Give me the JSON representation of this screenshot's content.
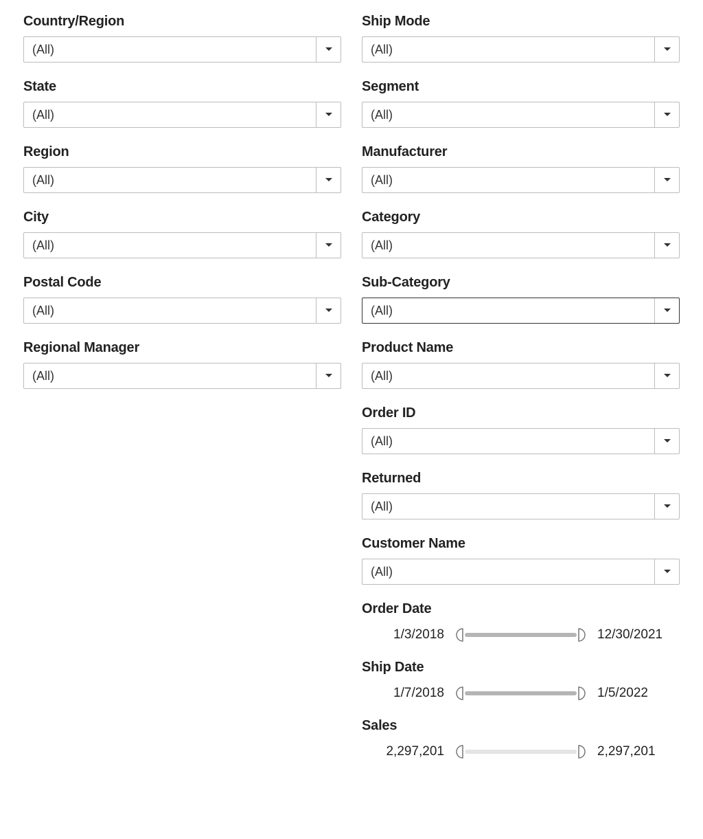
{
  "left": [
    {
      "name": "country-region",
      "label": "Country/Region",
      "value": "(All)"
    },
    {
      "name": "state",
      "label": "State",
      "value": "(All)"
    },
    {
      "name": "region",
      "label": "Region",
      "value": "(All)"
    },
    {
      "name": "city",
      "label": "City",
      "value": "(All)"
    },
    {
      "name": "postal-code",
      "label": "Postal Code",
      "value": "(All)"
    },
    {
      "name": "regional-manager",
      "label": "Regional Manager",
      "value": "(All)"
    }
  ],
  "right": [
    {
      "name": "ship-mode",
      "label": "Ship Mode",
      "value": "(All)"
    },
    {
      "name": "segment",
      "label": "Segment",
      "value": "(All)"
    },
    {
      "name": "manufacturer",
      "label": "Manufacturer",
      "value": "(All)"
    },
    {
      "name": "category",
      "label": "Category",
      "value": "(All)"
    },
    {
      "name": "sub-category",
      "label": "Sub-Category",
      "value": "(All)",
      "highlight": true
    },
    {
      "name": "product-name",
      "label": "Product Name",
      "value": "(All)"
    },
    {
      "name": "order-id",
      "label": "Order ID",
      "value": "(All)"
    },
    {
      "name": "returned",
      "label": "Returned",
      "value": "(All)"
    },
    {
      "name": "customer-name",
      "label": "Customer Name",
      "value": "(All)"
    }
  ],
  "sliders": [
    {
      "name": "order-date",
      "label": "Order Date",
      "from": "1/3/2018",
      "to": "12/30/2021",
      "track": "dark"
    },
    {
      "name": "ship-date",
      "label": "Ship Date",
      "from": "1/7/2018",
      "to": "1/5/2022",
      "track": "dark"
    },
    {
      "name": "sales",
      "label": "Sales",
      "from": "2,297,201",
      "to": "2,297,201",
      "track": "light"
    }
  ]
}
